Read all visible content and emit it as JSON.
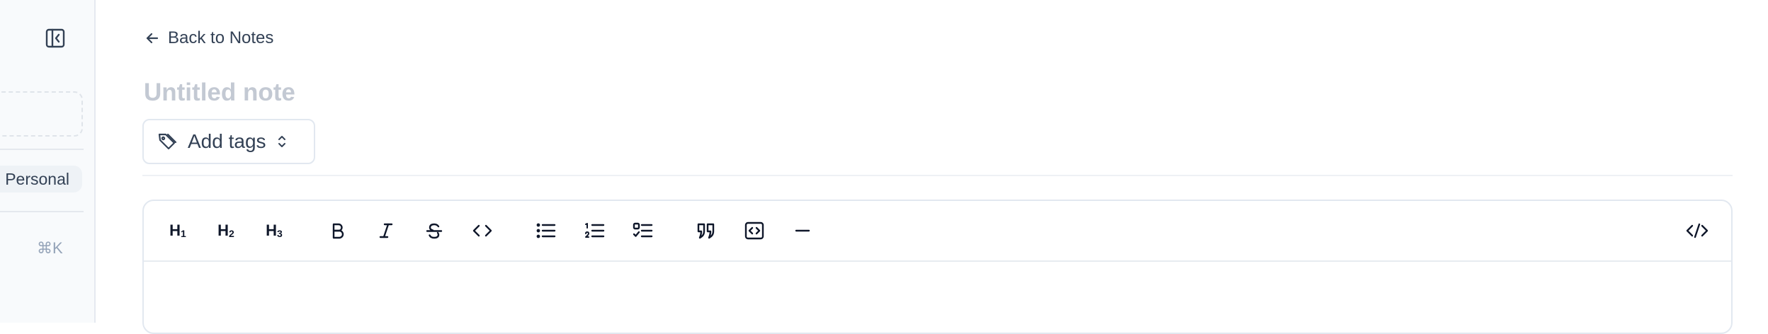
{
  "sidebar": {
    "tag_chip_label": "Personal",
    "search_shortcut": "⌘K"
  },
  "nav": {
    "back_label": "Back to Notes"
  },
  "note": {
    "title_placeholder": "Untitled note",
    "title_value": "",
    "add_tags_label": "Add tags"
  },
  "toolbar": {
    "heading1": "H",
    "heading1_level": "1",
    "heading2": "H",
    "heading2_level": "2",
    "heading3": "H",
    "heading3_level": "3"
  },
  "colors": {
    "text": "#334155",
    "muted": "#94a3b8",
    "placeholder": "#c3c9d3",
    "border": "#e2e8f0",
    "sidebar_bg": "#f8fafc"
  }
}
